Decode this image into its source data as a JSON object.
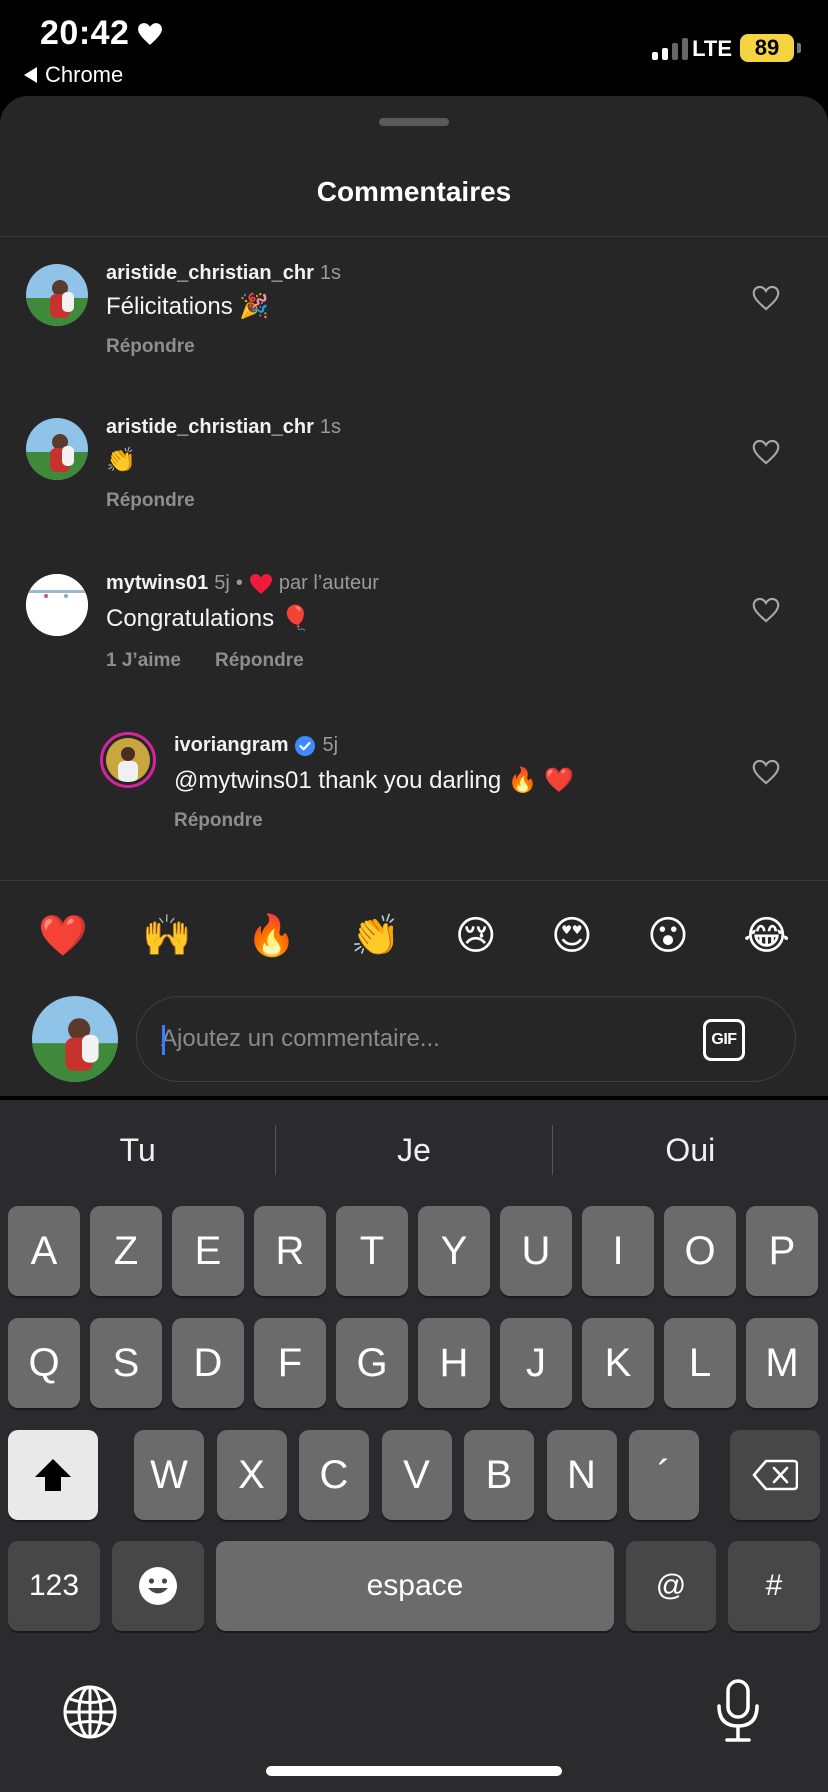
{
  "status_bar": {
    "time": "20:42",
    "back_app": "Chrome",
    "network": "LTE",
    "battery": "89"
  },
  "sheet": {
    "title": "Commentaires"
  },
  "comments": [
    {
      "username": "aristide_christian_chr",
      "time": "1s",
      "text": "Félicitations 🎉",
      "reply": "Répondre"
    },
    {
      "username": "aristide_christian_chr",
      "time": "1s",
      "text": "👏",
      "reply": "Répondre"
    },
    {
      "username": "mytwins01",
      "time": "5j",
      "separator": "•",
      "liked_by_author": "par l’auteur",
      "text": "Congratulations 🎈",
      "likes": "1 J’aime",
      "reply": "Répondre"
    },
    {
      "username": "ivoriangram",
      "time": "5j",
      "text": "@mytwins01 thank you darling 🔥 ❤️",
      "reply": "Répondre"
    }
  ],
  "reactions": [
    "❤️",
    "🙌",
    "🔥",
    "👏",
    "😢",
    "😍",
    "😮",
    "😂"
  ],
  "composer": {
    "placeholder": "Ajoutez un commentaire...",
    "gif_label": "GIF"
  },
  "keyboard": {
    "suggestions": [
      "Tu",
      "Je",
      "Oui"
    ],
    "row1": [
      "A",
      "Z",
      "E",
      "R",
      "T",
      "Y",
      "U",
      "I",
      "O",
      "P"
    ],
    "row2": [
      "Q",
      "S",
      "D",
      "F",
      "G",
      "H",
      "J",
      "K",
      "L",
      "M"
    ],
    "row3": [
      "W",
      "X",
      "C",
      "V",
      "B",
      "N",
      "´"
    ],
    "numbers_label": "123",
    "space_label": "espace",
    "at_label": "@",
    "hash_label": "#"
  },
  "colors": {
    "sheet_bg": "#262626",
    "keyboard_bg": "#2b2b2d",
    "like_red": "#ed1c3c",
    "verified_blue": "#3d8bff",
    "battery_yellow": "#f5d442"
  }
}
